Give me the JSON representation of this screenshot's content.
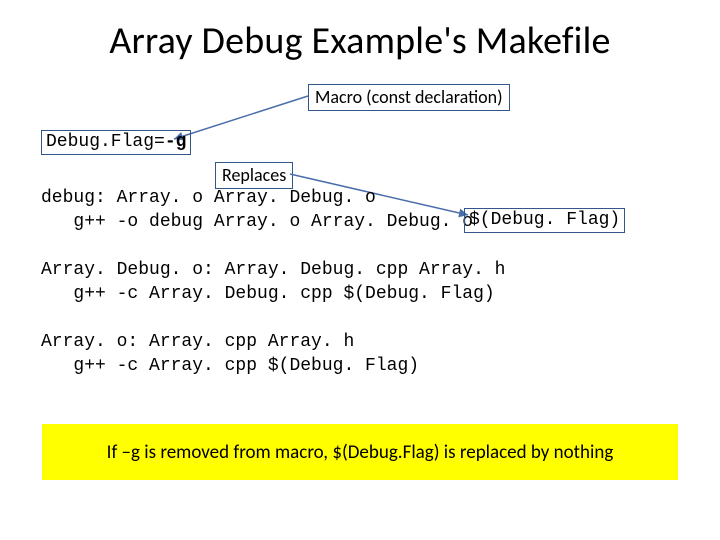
{
  "title": "Array Debug Example's Makefile",
  "callouts": {
    "macro": "Macro (const declaration)",
    "replaces": "Replaces"
  },
  "flag_def": {
    "name": "Debug.Flag=",
    "value": "-g"
  },
  "code_block_1": {
    "line1": "debug: Array. o Array. Debug. o",
    "line2": "   g++ -o debug Array. o Array. Debug. o"
  },
  "var_usage": " $(Debug. Flag)",
  "code_block_2": {
    "line1": "Array. Debug. o: Array. Debug. cpp Array. h",
    "line2": "   g++ -c Array. Debug. cpp $(Debug. Flag)"
  },
  "code_block_3": {
    "line1": "Array. o: Array. cpp Array. h",
    "line2": "   g++ -c Array. cpp $(Debug. Flag)"
  },
  "highlight_note": "If –g is removed from macro, $(Debug.Flag) is replaced by nothing"
}
